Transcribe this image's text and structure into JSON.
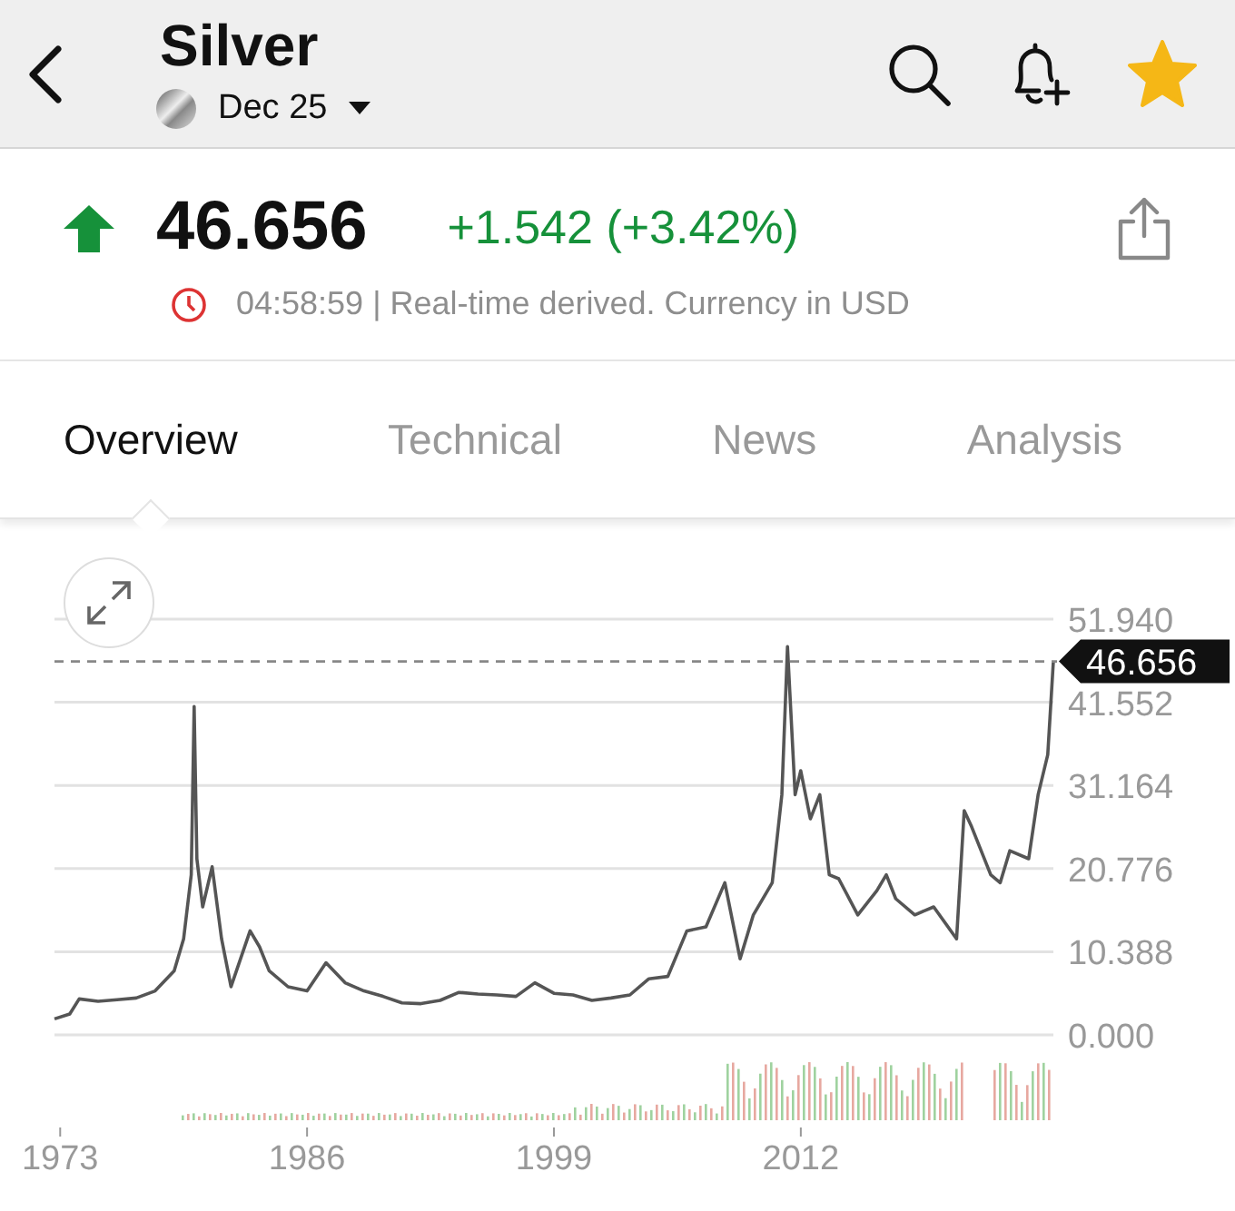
{
  "header": {
    "title": "Silver",
    "contract": "Dec 25",
    "watchlisted": true
  },
  "quote": {
    "rising": true,
    "price": "46.656",
    "change": "+1.542 (+3.42%)",
    "info": "04:58:59 | Real-time derived. Currency in USD"
  },
  "tabs": [
    {
      "label": "Overview",
      "selected": true
    },
    {
      "label": "Technical",
      "selected": false
    },
    {
      "label": "News",
      "selected": false
    },
    {
      "label": "Analysis",
      "selected": false
    }
  ],
  "chart": {
    "chart_data": {
      "type": "line",
      "grid": true,
      "xlim": [
        1972.7,
        2025.3
      ],
      "ylim": [
        0,
        51.94
      ],
      "xticks": [
        1973,
        1986,
        1999,
        2012
      ],
      "yticks": [
        {
          "value": 0,
          "label": "0.000"
        },
        {
          "value": 10.388,
          "label": "10.388"
        },
        {
          "value": 20.776,
          "label": "20.776"
        },
        {
          "value": 31.164,
          "label": "31.164"
        },
        {
          "value": 41.552,
          "label": "41.552"
        },
        {
          "value": 51.94,
          "label": "51.940"
        }
      ],
      "x": [
        1972.7,
        1973.5,
        1974,
        1975,
        1976,
        1977,
        1978,
        1979,
        1979.5,
        1979.9,
        1980.05,
        1980.2,
        1980.5,
        1981,
        1981.5,
        1982,
        1983,
        1983.5,
        1984,
        1985,
        1986,
        1987,
        1988,
        1989,
        1990,
        1991,
        1992,
        1993,
        1994,
        1995,
        1996,
        1997,
        1998,
        1999,
        2000,
        2001,
        2002,
        2003,
        2004,
        2005,
        2006,
        2007,
        2008,
        2008.8,
        2009.5,
        2010.5,
        2011,
        2011.3,
        2011.7,
        2012,
        2012.5,
        2013,
        2013.5,
        2014,
        2015,
        2016,
        2016.5,
        2017,
        2018,
        2019,
        2020.2,
        2020.6,
        2021,
        2022,
        2022.5,
        2023,
        2024,
        2024.5,
        2025,
        2025.3
      ],
      "series": [
        {
          "color": "#555555",
          "values": [
            2.0,
            2.6,
            4.5,
            4.2,
            4.4,
            4.6,
            5.5,
            8,
            12,
            20,
            41,
            22,
            16,
            21,
            12,
            6,
            13,
            11,
            8,
            6,
            5.5,
            9,
            6.5,
            5.5,
            4.8,
            4.0,
            3.9,
            4.3,
            5.3,
            5.1,
            5.0,
            4.8,
            6.5,
            5.2,
            5.0,
            4.3,
            4.6,
            5.0,
            7.0,
            7.3,
            13,
            13.5,
            19,
            9.5,
            15,
            19,
            30,
            48.5,
            30,
            33,
            27,
            30,
            20,
            19.5,
            15,
            18,
            20,
            17,
            15,
            16,
            12,
            28,
            26,
            20,
            19,
            23,
            22,
            30,
            35,
            46.7
          ]
        }
      ],
      "ref_lines": [
        {
          "axis": "y",
          "value": 46.656,
          "label": "46.656"
        }
      ]
    }
  }
}
